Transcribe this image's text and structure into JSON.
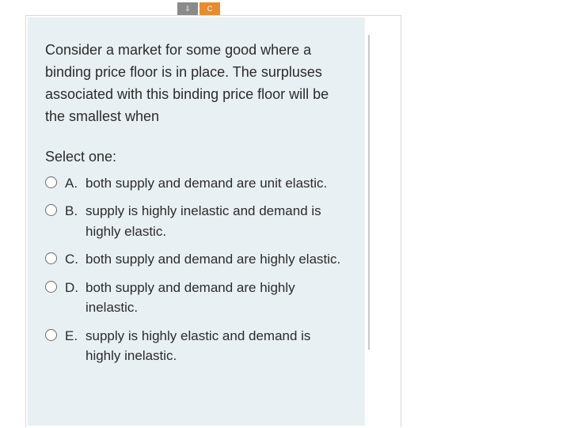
{
  "tabs": {
    "a": "⇩",
    "b": "C"
  },
  "question": {
    "stem": "Consider a market for some good where a binding price floor is in place. The surpluses associated with this binding price floor will be the smallest when",
    "select_label": "Select one:",
    "options": [
      {
        "letter": "A.",
        "text": "both supply and demand are unit elastic."
      },
      {
        "letter": "B.",
        "text": "supply is highly inelastic and demand is highly elastic."
      },
      {
        "letter": "C.",
        "text": "both supply and demand are highly elastic."
      },
      {
        "letter": "D.",
        "text": "both supply and demand are highly inelastic."
      },
      {
        "letter": "E.",
        "text": "supply is highly elastic and demand is highly inelastic."
      }
    ]
  }
}
